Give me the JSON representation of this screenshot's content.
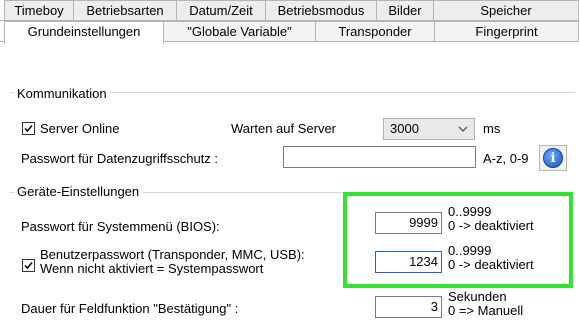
{
  "tabs_row1": [
    {
      "label": "Timeboy"
    },
    {
      "label": "Betriebsarten"
    },
    {
      "label": "Datum/Zeit"
    },
    {
      "label": "Betriebsmodus"
    },
    {
      "label": "Bilder"
    },
    {
      "label": "Speicher"
    }
  ],
  "tabs_row2": [
    {
      "label": "Grundeinstellungen",
      "active": true
    },
    {
      "label": "\"Globale Variable\""
    },
    {
      "label": "Transponder"
    },
    {
      "label": "Fingerprint"
    }
  ],
  "kommunikation": {
    "legend": "Kommunikation",
    "server_online_label": "Server Online",
    "server_online_checked": true,
    "warten_label": "Warten auf Server",
    "warten_value": "3000",
    "warten_unit": "ms",
    "passwort_label": "Passwort für Datenzugriffsschutz :",
    "passwort_value": "",
    "passwort_hint": "A-z, 0-9"
  },
  "geraete": {
    "legend": "Geräte-Einstellungen",
    "systemmenu_label": "Passwort für Systemmenü (BIOS):",
    "systemmenu_value": "9999",
    "systemmenu_range": "0..9999",
    "systemmenu_hint": "0 -> deaktiviert",
    "benutzer_label_1": "Benutzerpasswort (Transponder, MMC, USB):",
    "benutzer_label_2": "Wenn nicht aktiviert = Systempasswort",
    "benutzer_checked": true,
    "benutzer_value": "1234",
    "benutzer_range": "0..9999",
    "benutzer_hint": "0 -> deaktiviert",
    "dauer_label": "Dauer für Feldfunktion \"Bestätigung\" :",
    "dauer_value": "3",
    "dauer_unit": "Sekunden",
    "dauer_hint": "0 => Manuell"
  },
  "colors": {
    "highlight": "#32e332",
    "info": "#1a4fc2"
  }
}
